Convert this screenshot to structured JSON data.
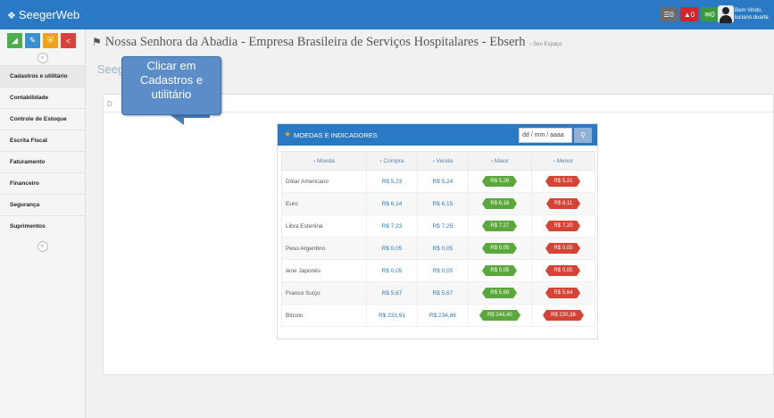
{
  "app": {
    "brand": "SeegerWeb"
  },
  "topbar": {
    "icons": [
      {
        "name": "messages-icon",
        "badge": "0"
      },
      {
        "name": "bell-icon",
        "badge": "0"
      },
      {
        "name": "mail-icon",
        "badge": "0"
      }
    ],
    "user_greeting": "Bem Vindo,",
    "user_name": "luciano.duarte"
  },
  "sidebar": {
    "quick_buttons": [
      "chart-icon",
      "pencil-icon",
      "shield-icon",
      "share-icon"
    ],
    "collapse_top": "«",
    "collapse_bottom": "«",
    "items": [
      {
        "label": "Cadastros e utilitário"
      },
      {
        "label": "Contabilidade"
      },
      {
        "label": "Controle de Estoque"
      },
      {
        "label": "Escrita Fiscal"
      },
      {
        "label": "Faturamento"
      },
      {
        "label": "Financeiro"
      },
      {
        "label": "Segurança"
      },
      {
        "label": "Suprimentos"
      }
    ]
  },
  "header": {
    "title": "Nossa Senhora da Abadia - Empresa Brasileira de Serviços Hospitalares - Ebserh",
    "breadcrumb": "› Seu Espaço"
  },
  "main": {
    "section_title": "Seeg",
    "tab_label": "D"
  },
  "callout": {
    "text_line1": "Clicar em",
    "text_line2": "Cadastros e",
    "text_line3": "utilitário"
  },
  "widget": {
    "title": "MOEDAS E INDICADORES",
    "date_placeholder": "dd / mm / aaaa",
    "columns": [
      "› Moeda",
      "› Compra",
      "› Venda",
      "› Maior",
      "› Menor"
    ],
    "rows": [
      {
        "moeda": "Dólar Americano",
        "compra": "R$ 5,23",
        "venda": "R$ 5,24",
        "maior": "R$ 5,26",
        "menor": "R$ 5,21"
      },
      {
        "moeda": "Euro",
        "compra": "R$ 6,14",
        "venda": "R$ 6,15",
        "maior": "R$ 6,16",
        "menor": "R$ 6,11"
      },
      {
        "moeda": "Libra Esterlina",
        "compra": "R$ 7,23",
        "venda": "R$ 7,25",
        "maior": "R$ 7,27",
        "menor": "R$ 7,20"
      },
      {
        "moeda": "Peso Argentino",
        "compra": "R$ 0,05",
        "venda": "R$ 0,05",
        "maior": "R$ 0,05",
        "menor": "R$ 0,05"
      },
      {
        "moeda": "Iene Japonês",
        "compra": "R$ 0,05",
        "venda": "R$ 0,05",
        "maior": "R$ 0,05",
        "menor": "R$ 0,05"
      },
      {
        "moeda": "Franco Suíço",
        "compra": "R$ 5,67",
        "venda": "R$ 5,67",
        "maior": "R$ 5,69",
        "menor": "R$ 5,64"
      },
      {
        "moeda": "Bitcoin",
        "compra": "R$ 233,91",
        "venda": "R$ 234,86",
        "maior": "R$ 244,40",
        "menor": "R$ 230,38"
      }
    ]
  },
  "colors": {
    "topbar": "#2a79c4",
    "up": "#5aa83c",
    "down": "#d44333",
    "callout": "#5b8dc8"
  }
}
